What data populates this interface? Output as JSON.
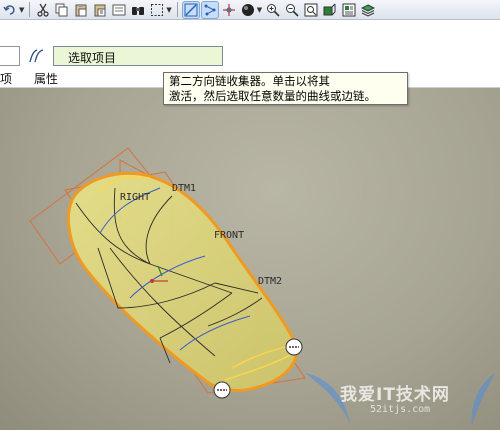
{
  "toolbar": {
    "icons": [
      "undo-icon",
      "cut-icon",
      "copy-icon",
      "paste-icon",
      "paste-special-icon",
      "regenerate-icon",
      "find-icon",
      "select-box-icon",
      "datum-display-icon",
      "sketch-icon",
      "spin-center-icon",
      "shading-icon",
      "zoom-in-icon",
      "zoom-out-icon",
      "refit-icon",
      "orient-icon",
      "saved-views-icon",
      "layers-icon"
    ]
  },
  "dashboard": {
    "collector_text": "选取项目",
    "tabs": [
      {
        "label": "项"
      },
      {
        "label": "属性"
      }
    ]
  },
  "tooltip": {
    "line1": "第二方向链收集器。单击以将其",
    "line2": "激活，然后选取任意数量的曲线或边链。"
  },
  "viewport": {
    "datum_labels": {
      "right": "RIGHT",
      "dtm1": "DTM1",
      "front": "FRONT",
      "dtm2": "DTM2"
    },
    "colors": {
      "surface_fill": "#d8d27a",
      "edge_highlight": "#f39a1c",
      "datum_plane": "#e0803a",
      "background": "#a7a493"
    }
  },
  "watermark": {
    "text": "我爱IT技术网",
    "url": "52itjs.com"
  }
}
